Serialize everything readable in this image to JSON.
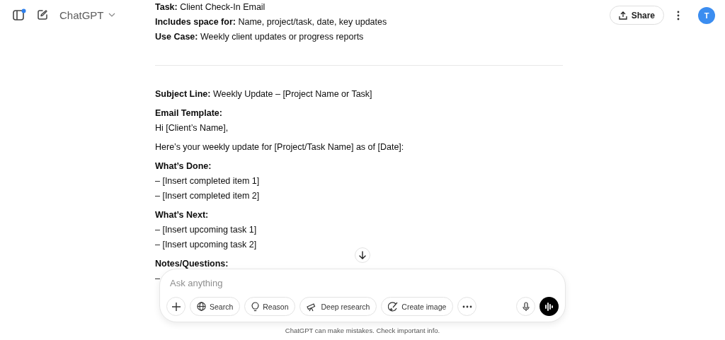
{
  "header": {
    "title": "ChatGPT",
    "sidebar_notification": true,
    "share_label": "Share",
    "avatar_letter": "T"
  },
  "content": [
    {
      "kind": "paragraph",
      "lines": [
        {
          "text": "**Task:** Client Check-In Email"
        },
        {
          "text": "**Includes space for:** Name, project/task, date, key updates"
        },
        {
          "text": "**Use Case:** Weekly client updates or progress reports"
        }
      ]
    },
    {
      "kind": "divider"
    },
    {
      "kind": "paragraph",
      "lines": [
        {
          "text": "**Subject Line:** Weekly Update – [Project Name or Task]"
        }
      ]
    },
    {
      "kind": "paragraph",
      "lines": [
        {
          "text": "Email Template:",
          "bold": true
        },
        {
          "text": "Hi [Client’s Name],"
        }
      ]
    },
    {
      "kind": "paragraph",
      "lines": [
        {
          "text": "Here’s your weekly update for [Project/Task Name] as of [Date]:"
        }
      ]
    },
    {
      "kind": "paragraph",
      "lines": [
        {
          "text": "What’s Done:",
          "bold": true
        },
        {
          "text": "– [Insert completed item 1]"
        },
        {
          "text": "– [Insert completed item 2]"
        }
      ]
    },
    {
      "kind": "paragraph",
      "lines": [
        {
          "text": "What’s Next:",
          "bold": true
        },
        {
          "text": "– [Insert upcoming task 1]"
        },
        {
          "text": "– [Insert upcoming task 2]"
        }
      ]
    },
    {
      "kind": "paragraph",
      "lines": [
        {
          "text": "Notes/Questions:",
          "bold": true
        },
        {
          "text": "–"
        }
      ]
    }
  ],
  "composer": {
    "placeholder": "Ask anything",
    "tools": [
      {
        "kind": "plus"
      },
      {
        "kind": "globe",
        "label": "Search"
      },
      {
        "kind": "bulb",
        "label": "Reason"
      },
      {
        "kind": "telescope",
        "label": "Deep research"
      },
      {
        "kind": "brush",
        "label": "Create image"
      },
      {
        "kind": "more"
      }
    ]
  },
  "disclaimer": "ChatGPT can make mistakes. Check important info."
}
